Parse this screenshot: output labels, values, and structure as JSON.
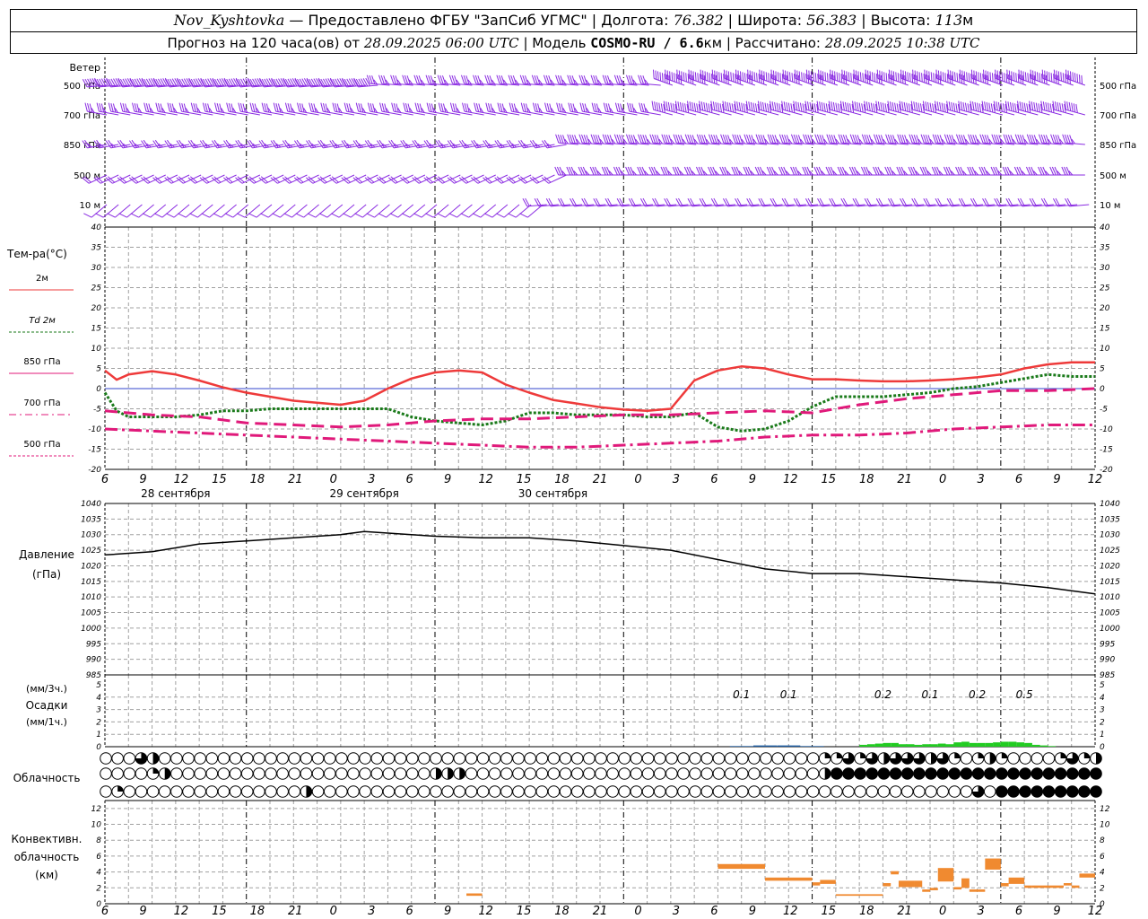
{
  "header": {
    "station": "Nov_Kyshtovka",
    "provider": "— Предоставлено ФГБУ \"ЗапСиб УГМС\"",
    "lon_label": "Долгота:",
    "lon_value": "76.382",
    "lat_label": "Широта:",
    "lat_value": "56.383",
    "alt_label": "Высота:",
    "alt_value": "113",
    "alt_unit": "м",
    "forecast_label": "Прогноз на 120 часа(ов) от",
    "forecast_time": "28.09.2025 06:00 UTC",
    "model_label": "Модель",
    "model_name": "COSMO-RU / 6.6",
    "model_unit": "км",
    "calc_label": "Рассчитано:",
    "calc_time": "28.09.2025 10:38 UTC"
  },
  "colors": {
    "wind": "#8a2be2",
    "t2m": "#ee3a3a",
    "td2m": "#1a7a1a",
    "t850": "#e0197a",
    "t700": "#e0197a",
    "t500": "#e0197a",
    "zero_line": "#3344cc",
    "pressure": "#000000",
    "precip_3h": "#1a5aa0",
    "precip_1h": "#22cc22",
    "convective": "#f08a30",
    "grid": "#a0a0a0"
  },
  "time_axis": {
    "start_hour": 6,
    "hours_total": 126,
    "tick_labels": [
      "6",
      "9",
      "12",
      "15",
      "18",
      "21",
      "0",
      "3",
      "6",
      "9",
      "12",
      "15",
      "18",
      "21",
      "0",
      "3",
      "6",
      "9",
      "12",
      "15",
      "18",
      "21",
      "0",
      "3",
      "6",
      "9",
      "12"
    ],
    "day_labels": [
      {
        "hour": 9,
        "text": "28 сентября"
      },
      {
        "hour": 33,
        "text": "29 сентября"
      },
      {
        "hour": 57,
        "text": "30 сентября"
      }
    ]
  },
  "wind_panel": {
    "title": "Ветер",
    "levels": [
      "500 гПа",
      "700 гПа",
      "850 гПа",
      "500 м",
      "10 м"
    ],
    "barbs": {
      "step_hours": 1.5,
      "segments": [
        {
          "level": 0,
          "from": 0,
          "to": 36,
          "dir": 265,
          "speed": 60
        },
        {
          "level": 0,
          "from": 36,
          "to": 72,
          "dir": 275,
          "speed": 35
        },
        {
          "level": 0,
          "from": 72,
          "to": 126,
          "dir": 290,
          "speed": 80
        },
        {
          "level": 1,
          "from": 0,
          "to": 72,
          "dir": 280,
          "speed": 35
        },
        {
          "level": 1,
          "from": 72,
          "to": 126,
          "dir": 285,
          "speed": 60
        },
        {
          "level": 2,
          "from": 0,
          "to": 60,
          "dir": 260,
          "speed": 25
        },
        {
          "level": 2,
          "from": 60,
          "to": 126,
          "dir": 275,
          "speed": 45
        },
        {
          "level": 3,
          "from": 0,
          "to": 60,
          "dir": 245,
          "speed": 20
        },
        {
          "level": 3,
          "from": 60,
          "to": 126,
          "dir": 270,
          "speed": 35
        },
        {
          "level": 4,
          "from": 0,
          "to": 56,
          "dir": 230,
          "speed": 10
        },
        {
          "level": 4,
          "from": 56,
          "to": 126,
          "dir": 265,
          "speed": 20
        }
      ]
    }
  },
  "chart_data": [
    {
      "type": "line",
      "title": "Тем-ра(°С)",
      "ylim": [
        -20,
        40
      ],
      "yticks": [
        -20,
        -15,
        -10,
        -5,
        0,
        5,
        10,
        15,
        20,
        25,
        30,
        35,
        40
      ],
      "legend": [
        "2м",
        "Td 2м",
        "850 гПа",
        "700 гПа",
        "500 гПа"
      ],
      "series": [
        {
          "name": "2м",
          "x": [
            0,
            1.5,
            3,
            6,
            9,
            12,
            15,
            18,
            21,
            24,
            27,
            30,
            33,
            36,
            39,
            42,
            45,
            48,
            51,
            54,
            57,
            60,
            63,
            66,
            69,
            72,
            75,
            78,
            81,
            84,
            87,
            90,
            93,
            96,
            99,
            102,
            105,
            108,
            111,
            114,
            117,
            120,
            123,
            126
          ],
          "y": [
            4.5,
            2.2,
            3.5,
            4.3,
            3.5,
            2,
            0.3,
            -1,
            -2,
            -3,
            -3.5,
            -4,
            -3,
            0,
            2.5,
            4,
            4.5,
            4,
            1,
            -1,
            -2.8,
            -3.7,
            -4.6,
            -5.2,
            -5.5,
            -5,
            2,
            4.5,
            5.5,
            5,
            3.5,
            2.3,
            2.3,
            2,
            1.8,
            1.8,
            2,
            2.3,
            2.8,
            3.5,
            5,
            6,
            6.5,
            6.5
          ]
        },
        {
          "name": "Td 2м",
          "x": [
            0,
            1.5,
            3,
            6,
            9,
            12,
            15,
            18,
            21,
            24,
            27,
            30,
            33,
            36,
            39,
            42,
            45,
            48,
            51,
            54,
            57,
            60,
            63,
            66,
            69,
            72,
            75,
            78,
            81,
            84,
            87,
            90,
            93,
            96,
            99,
            102,
            105,
            108,
            111,
            114,
            117,
            120,
            123,
            126
          ],
          "y": [
            -1,
            -5.5,
            -7,
            -7,
            -7,
            -6.5,
            -5.5,
            -5.5,
            -5,
            -5,
            -5,
            -5,
            -5,
            -5,
            -7,
            -8,
            -8.5,
            -9,
            -8,
            -6,
            -6,
            -6.5,
            -6.5,
            -6.5,
            -7,
            -7,
            -6,
            -9.5,
            -10.5,
            -10,
            -8,
            -4.5,
            -2,
            -2,
            -2,
            -1.5,
            -1,
            0,
            0.5,
            1.5,
            2.5,
            3.5,
            3,
            3
          ]
        },
        {
          "name": "850 гПа",
          "x": [
            0,
            6,
            12,
            18,
            24,
            30,
            36,
            42,
            48,
            54,
            60,
            66,
            72,
            78,
            84,
            90,
            96,
            102,
            108,
            114,
            120,
            126
          ],
          "y": [
            -5.5,
            -6.5,
            -7,
            -8.5,
            -9,
            -9.5,
            -9,
            -8,
            -7.5,
            -7.5,
            -7,
            -6.5,
            -6.5,
            -6,
            -5.5,
            -6,
            -4,
            -2.5,
            -1.5,
            -0.5,
            -0.5,
            0
          ]
        },
        {
          "name": "700 гПа",
          "x": [
            0,
            6,
            12,
            18,
            24,
            30,
            36,
            42,
            48,
            54,
            60,
            66,
            72,
            78,
            84,
            90,
            96,
            102,
            108,
            114,
            120,
            126
          ],
          "y": [
            -10,
            -10.5,
            -11,
            -11.5,
            -12,
            -12.5,
            -13,
            -13.5,
            -14,
            -14.5,
            -14.5,
            -14,
            -13.5,
            -13,
            -12,
            -11.5,
            -11.5,
            -11,
            -10,
            -9.5,
            -9,
            -9
          ]
        }
      ]
    },
    {
      "type": "line",
      "title": "Давление",
      "ylabel": "(гПа)",
      "ylim": [
        985,
        1040
      ],
      "yticks": [
        985,
        990,
        995,
        1000,
        1005,
        1010,
        1015,
        1020,
        1025,
        1030,
        1035,
        1040
      ],
      "series": [
        {
          "name": "",
          "x": [
            0,
            6,
            12,
            18,
            24,
            30,
            33,
            36,
            42,
            48,
            54,
            60,
            66,
            72,
            78,
            84,
            90,
            96,
            102,
            108,
            114,
            120,
            126
          ],
          "y": [
            1023.5,
            1024.5,
            1027,
            1028,
            1029,
            1030,
            1031,
            1030.5,
            1029.5,
            1029,
            1029,
            1028,
            1026.5,
            1025,
            1022,
            1019,
            1017.5,
            1017.5,
            1016.5,
            1015.5,
            1014.5,
            1013,
            1011
          ]
        }
      ]
    },
    {
      "type": "bar",
      "title": "Осадки",
      "ylabel_top": "(мм/3ч.)",
      "ylabel_bottom": "(мм/1ч.)",
      "ylim": [
        0,
        5
      ],
      "yticks": [
        0,
        1,
        2,
        3,
        4,
        5
      ],
      "labels": [
        {
          "hour": 81,
          "text": "0.1"
        },
        {
          "hour": 87,
          "text": "0.1"
        },
        {
          "hour": 99,
          "text": "0.2"
        },
        {
          "hour": 105,
          "text": "0.1"
        },
        {
          "hour": 111,
          "text": "0.2"
        },
        {
          "hour": 117,
          "text": "0.5"
        }
      ],
      "series": [
        {
          "name": "3ч",
          "x": [
            81,
            84,
            87,
            90
          ],
          "y": [
            0.05,
            0.1,
            0.1,
            0.05
          ]
        },
        {
          "name": "1ч",
          "x": [
            96,
            97,
            98,
            99,
            100,
            101,
            102,
            103,
            104,
            105,
            106,
            107,
            108,
            109,
            110,
            111,
            112,
            113,
            114,
            115,
            116,
            117,
            118,
            119,
            120
          ],
          "y": [
            0.15,
            0.2,
            0.25,
            0.3,
            0.3,
            0.2,
            0.2,
            0.15,
            0.2,
            0.2,
            0.25,
            0.2,
            0.35,
            0.4,
            0.3,
            0.3,
            0.3,
            0.35,
            0.4,
            0.4,
            0.35,
            0.3,
            0.15,
            0.1,
            0.05
          ]
        }
      ]
    },
    {
      "type": "table",
      "title": "Облачность",
      "rows": [
        "upper",
        "middle",
        "lower"
      ],
      "step_hours": 1.5,
      "values": [
        [
          0,
          0,
          0,
          0.75,
          0.5,
          0,
          0,
          0,
          0,
          0,
          0,
          0,
          0,
          0,
          0,
          0,
          0,
          0,
          0,
          0,
          0,
          0,
          0,
          0,
          0,
          0,
          0,
          0,
          0,
          0,
          0,
          0,
          0,
          0,
          0,
          0,
          0,
          0,
          0,
          0,
          0,
          0,
          0,
          0,
          0,
          0,
          0,
          0,
          0,
          0,
          0,
          0,
          0,
          0,
          0,
          0,
          0,
          0,
          0,
          0,
          0,
          0.25,
          0.25,
          0.75,
          0.25,
          0.75,
          0.5,
          0.75,
          0.75,
          0.75,
          0.5,
          0.75,
          0.25,
          0,
          0.25,
          0.5,
          0.25,
          0,
          0,
          0,
          0,
          0.25,
          0.75,
          0.25,
          0.5,
          0,
          0,
          0,
          0,
          0,
          0,
          0.25,
          1,
          1,
          0.5,
          1,
          0.75,
          1,
          1,
          1,
          0.75,
          0.5,
          0.75,
          0.5,
          0.5,
          0.5
        ],
        [
          0,
          0,
          0,
          0,
          0.25,
          0.5,
          0,
          0,
          0,
          0,
          0,
          0,
          0,
          0,
          0,
          0,
          0,
          0,
          0,
          0,
          0,
          0,
          0,
          0,
          0,
          0,
          0,
          0,
          0.5,
          0.5,
          0.5,
          0,
          0,
          0,
          0,
          0,
          0,
          0,
          0,
          0,
          0,
          0,
          0,
          0,
          0,
          0,
          0,
          0,
          0,
          0,
          0,
          0,
          0,
          0,
          0,
          0,
          0,
          0,
          0,
          0,
          0,
          0.5,
          1,
          1,
          1,
          1,
          1,
          1,
          1,
          1,
          1,
          1,
          1,
          1,
          1,
          1,
          1,
          1,
          1,
          1,
          1,
          1,
          1,
          1,
          1,
          1,
          1,
          1,
          1,
          1,
          1,
          1,
          1,
          1,
          1,
          0.5,
          1,
          1,
          1,
          1,
          1,
          1,
          1,
          1,
          1,
          1
        ],
        [
          0,
          0.25,
          0,
          0,
          0,
          0,
          0,
          0,
          0,
          0,
          0,
          0,
          0,
          0,
          0,
          0,
          0,
          0.5,
          0,
          0,
          0,
          0,
          0,
          0,
          0,
          0,
          0,
          0,
          0,
          0,
          0,
          0,
          0,
          0,
          0,
          0,
          0,
          0,
          0,
          0,
          0,
          0,
          0,
          0,
          0,
          0,
          0,
          0,
          0,
          0,
          0,
          0,
          0,
          0,
          0,
          0,
          0,
          0,
          0,
          0,
          0,
          0,
          0,
          0,
          0,
          0,
          0,
          0,
          0,
          0,
          0,
          0,
          0,
          0,
          0.75,
          0,
          1,
          1,
          1,
          1,
          1,
          1,
          1,
          1,
          1,
          1,
          1,
          1,
          1,
          1,
          1,
          1,
          1,
          1,
          1,
          1,
          1,
          1,
          1,
          1,
          1,
          1,
          1,
          1,
          1,
          1,
          1,
          1,
          1,
          1,
          1,
          1,
          1,
          1,
          1
        ]
      ]
    },
    {
      "type": "bar",
      "title": "Конвективн.",
      "subtitle": "облачность",
      "ylabel": "(км)",
      "ylim": [
        0,
        13
      ],
      "yticks": [
        0,
        2,
        4,
        6,
        8,
        10,
        12
      ],
      "bars": [
        {
          "from": 46,
          "to": 48,
          "bottom": 1.0,
          "top": 1.3
        },
        {
          "from": 78,
          "to": 84,
          "bottom": 4.4,
          "top": 5.0
        },
        {
          "from": 84,
          "to": 90,
          "bottom": 2.9,
          "top": 3.3
        },
        {
          "from": 90,
          "to": 91,
          "bottom": 2.3,
          "top": 2.7
        },
        {
          "from": 91,
          "to": 93,
          "bottom": 2.5,
          "top": 3.0
        },
        {
          "from": 93,
          "to": 99,
          "bottom": 1.0,
          "top": 1.2
        },
        {
          "from": 99,
          "to": 100,
          "bottom": 2.2,
          "top": 2.6
        },
        {
          "from": 100,
          "to": 101,
          "bottom": 3.7,
          "top": 4.1
        },
        {
          "from": 101,
          "to": 103,
          "bottom": 2.1,
          "top": 2.9
        },
        {
          "from": 103,
          "to": 104,
          "bottom": 2.1,
          "top": 2.9
        },
        {
          "from": 104,
          "to": 105,
          "bottom": 1.5,
          "top": 1.8
        },
        {
          "from": 105,
          "to": 106,
          "bottom": 1.7,
          "top": 2.0
        },
        {
          "from": 106,
          "to": 108,
          "bottom": 2.8,
          "top": 4.5
        },
        {
          "from": 108,
          "to": 109,
          "bottom": 1.8,
          "top": 2.1
        },
        {
          "from": 109,
          "to": 110,
          "bottom": 2.0,
          "top": 3.2
        },
        {
          "from": 110,
          "to": 112,
          "bottom": 1.5,
          "top": 1.8
        },
        {
          "from": 112,
          "to": 114,
          "bottom": 4.3,
          "top": 5.7
        },
        {
          "from": 114,
          "to": 115,
          "bottom": 2.2,
          "top": 2.6
        },
        {
          "from": 115,
          "to": 117,
          "bottom": 2.5,
          "top": 3.3
        },
        {
          "from": 117,
          "to": 118,
          "bottom": 2.0,
          "top": 2.3
        },
        {
          "from": 118,
          "to": 122,
          "bottom": 2.0,
          "top": 2.3
        },
        {
          "from": 122,
          "to": 123,
          "bottom": 2.3,
          "top": 2.6
        },
        {
          "from": 123,
          "to": 124,
          "bottom": 2.0,
          "top": 2.3
        },
        {
          "from": 124,
          "to": 126,
          "bottom": 3.3,
          "top": 3.8
        }
      ]
    }
  ]
}
